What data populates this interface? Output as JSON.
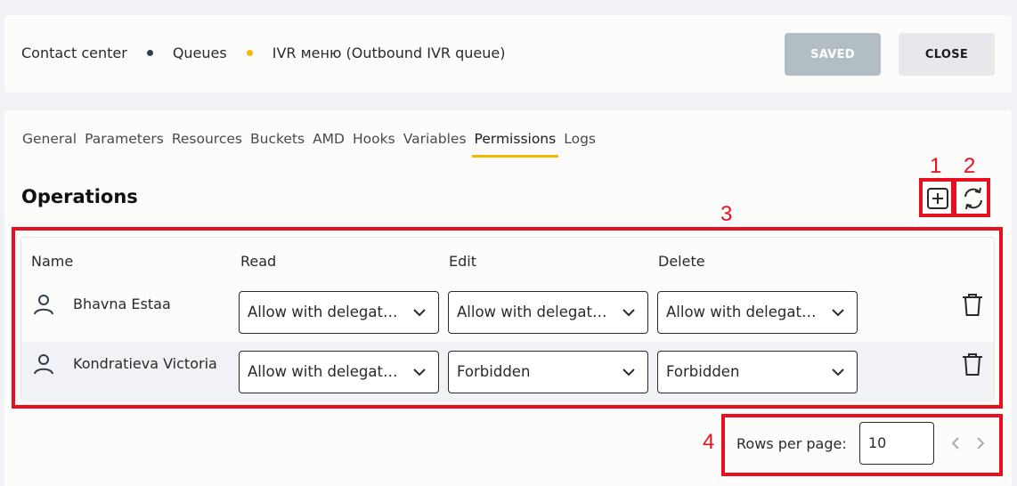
{
  "breadcrumb": {
    "items": [
      "Contact center",
      "Queues",
      "IVR меню (Outbound IVR queue)"
    ],
    "dot_colors": [
      "#2c3e50",
      "#f5b800"
    ]
  },
  "header": {
    "saved_label": "SAVED",
    "close_label": "CLOSE"
  },
  "tabs": [
    "General",
    "Parameters",
    "Resources",
    "Buckets",
    "AMD",
    "Hooks",
    "Variables",
    "Permissions",
    "Logs"
  ],
  "active_tab": "Permissions",
  "operations": {
    "title": "Operations"
  },
  "table": {
    "headers": {
      "name": "Name",
      "read": "Read",
      "edit": "Edit",
      "delete": "Delete"
    },
    "rows": [
      {
        "name": "Bhavna Estaa",
        "read": "Allow with delegation",
        "edit": "Allow with delegation",
        "delete": "Allow with delegation"
      },
      {
        "name": "Kondratieva Victoria",
        "read": "Allow with delegation",
        "edit": "Forbidden",
        "delete": "Forbidden"
      }
    ]
  },
  "pagination": {
    "rows_per_page_label": "Rows per page:",
    "rows_per_page_value": "10"
  },
  "annotations": [
    "1",
    "2",
    "3",
    "4"
  ],
  "colors": {
    "accent": "#f5b800",
    "annotation": "#e8101e",
    "saved_bg": "#b3bec4"
  }
}
